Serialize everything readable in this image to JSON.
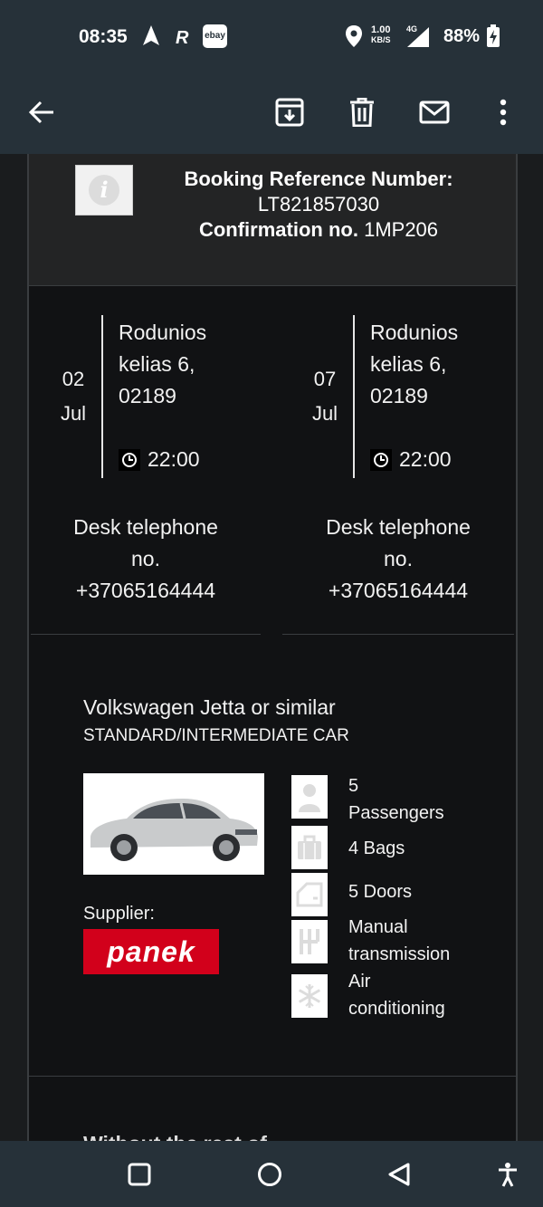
{
  "status_bar": {
    "time": "08:35",
    "ebay_label": "ebay",
    "speed_value": "1.00",
    "speed_unit": "KB/S",
    "network": "4G",
    "battery": "88%"
  },
  "toolbar": {
    "back_icon": "back-arrow-icon",
    "archive_icon": "archive-icon",
    "delete_icon": "trash-icon",
    "mail_icon": "mail-icon",
    "more_icon": "more-vert-icon"
  },
  "booking": {
    "ref_label": "Booking Reference Number:",
    "ref_value": "LT821857030",
    "conf_label": "Confirmation no.",
    "conf_value": "1MP206"
  },
  "pickup": {
    "day": "02",
    "month": "Jul",
    "address_line1": "Rodunios",
    "address_line2": "kelias 6,",
    "address_line3": "02189",
    "time": "22:00",
    "desk_line1": "Desk telephone",
    "desk_line2": "no.",
    "desk_line3": "+37065164444"
  },
  "dropoff": {
    "day": "07",
    "month": "Jul",
    "address_line1": "Rodunios",
    "address_line2": "kelias 6,",
    "address_line3": "02189",
    "time": "22:00",
    "desk_line1": "Desk telephone",
    "desk_line2": "no.",
    "desk_line3": "+37065164444"
  },
  "car": {
    "title": "Volkswagen Jetta or similar",
    "category": "STANDARD/INTERMEDIATE CAR",
    "supplier_label": "Supplier:",
    "supplier_logo_text": "panek",
    "features": [
      {
        "icon": "passenger-icon",
        "line1": "5",
        "line2": "Passengers"
      },
      {
        "icon": "bag-icon",
        "line1": "4 Bags",
        "line2": ""
      },
      {
        "icon": "door-icon",
        "line1": "5 Doors",
        "line2": ""
      },
      {
        "icon": "gear-shift-icon",
        "line1": "Manual",
        "line2": "transmission"
      },
      {
        "icon": "snowflake-icon",
        "line1": "Air",
        "line2": "conditioning"
      }
    ]
  },
  "cut_off_text": "Without the rest of",
  "colors": {
    "system_bar": "#263139",
    "card_bg": "#111214",
    "header_bg": "#232425",
    "supplier_red": "#d2001b"
  }
}
